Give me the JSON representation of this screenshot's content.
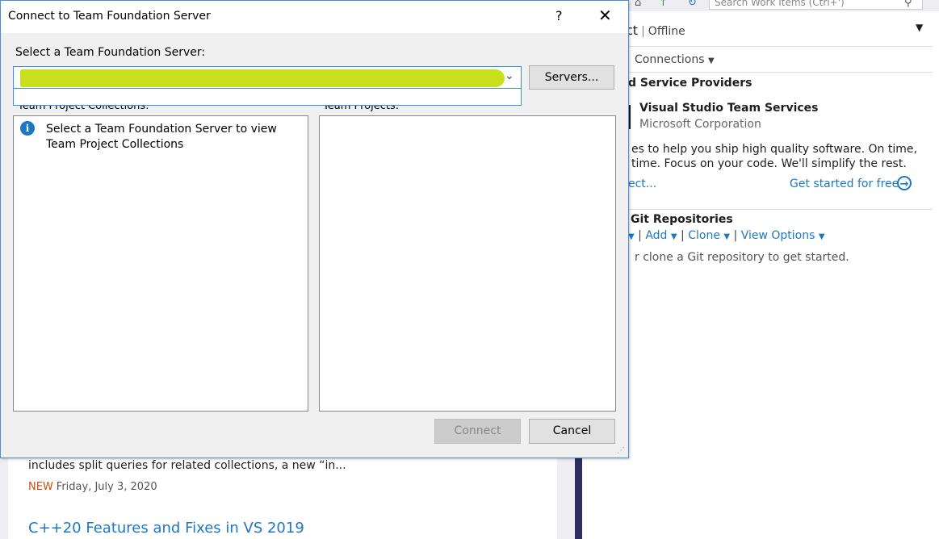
{
  "start_page": {
    "news_snippet": "includes split queries for related collections, a new “in...",
    "news_badge": "NEW",
    "news_date": "Friday, July 3, 2020",
    "news_title": "C++20 Features and Fixes in VS 2019"
  },
  "team_explorer": {
    "search_placeholder": "Search Work Items (Ctrl+')",
    "title_fragment": "ct",
    "status": "Offline",
    "connections_label": "Connections",
    "hosted_section": "d Service Providers",
    "vsts_name": "Visual Studio Team Services",
    "vsts_company": "Microsoft Corporation",
    "vsts_desc_line1": "es to help you ship high quality software. On time,",
    "vsts_desc_line2": "time. Focus on your code. We'll simplify the rest.",
    "connect_link": "ect...",
    "get_started_link": "Get started for free",
    "git_section": "Git Repositories",
    "git_add": "Add",
    "git_clone": "Clone",
    "git_view_options": "View Options",
    "git_hint": "r clone a Git repository to get started."
  },
  "dialog": {
    "title": "Connect to Team Foundation Server",
    "help": "?",
    "close": "✕",
    "server_label": "Select a Team Foundation Server:",
    "servers_button": "Servers...",
    "collections_label": "Team Project Collections:",
    "projects_label": "Team Projects:",
    "info_message": "Select a Team Foundation Server to view Team Project Collections",
    "connect_button": "Connect",
    "cancel_button": "Cancel"
  },
  "colors": {
    "accent": "#1e77c4",
    "highlight": "#c8e01c",
    "new_badge": "#c74f0a"
  }
}
